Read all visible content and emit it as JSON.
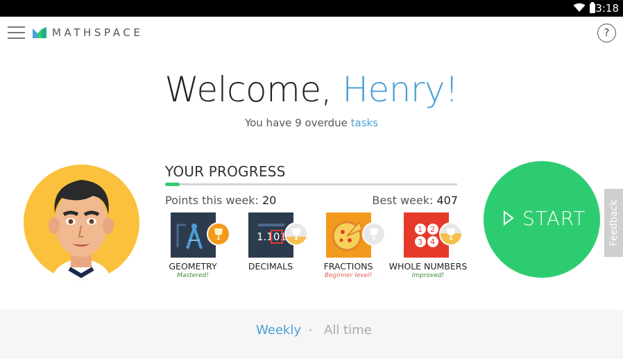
{
  "statusbar": {
    "time": "3:18"
  },
  "header": {
    "brand": "MATHSPACE",
    "help_label": "?"
  },
  "welcome": {
    "greeting": "Welcome, ",
    "name": "Henry!"
  },
  "overdue": {
    "prefix": "You have 9 overdue ",
    "link": "tasks"
  },
  "progress": {
    "title": "YOUR PROGRESS",
    "fill_fraction": 0.05,
    "points_label": "Points this week: ",
    "points_value": "20",
    "best_label": "Best week: ",
    "best_value": "407"
  },
  "topics": [
    {
      "name": "GEOMETRY",
      "status": "Mastered!",
      "status_color": "#3a8a3a",
      "tile_color": "#2d3b4e",
      "trophy": "gold"
    },
    {
      "name": "DECIMALS",
      "status": "",
      "status_color": "#3a8a3a",
      "tile_color": "#2d3b4e",
      "trophy": "silver-partial"
    },
    {
      "name": "FRACTIONS",
      "status": "Beginner level!",
      "status_color": "#e0605a",
      "tile_color": "#f39a1e",
      "trophy": "silver"
    },
    {
      "name": "WHOLE NUMBERS",
      "status": "Improved!",
      "status_color": "#3a8a3a",
      "tile_color": "#e53a2a",
      "trophy": "gold-partial"
    }
  ],
  "start": {
    "label": "START"
  },
  "feedback": {
    "label": "Feedback"
  },
  "footer": {
    "weekly": "Weekly",
    "alltime": "All time"
  },
  "colors": {
    "accent": "#4a9fd8",
    "green": "#2ecc71"
  }
}
